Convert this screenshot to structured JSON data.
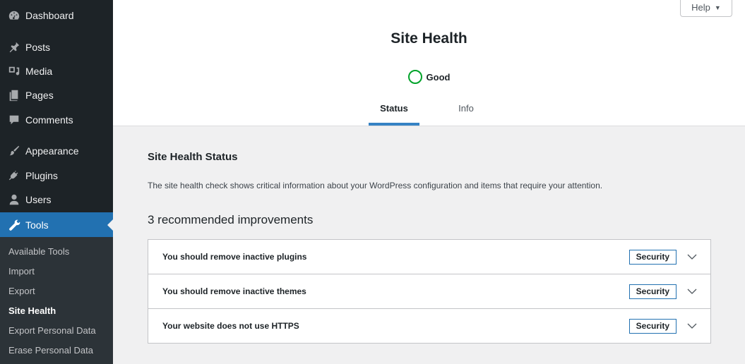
{
  "sidebar": {
    "items": [
      {
        "label": "Dashboard",
        "icon": "dashboard-icon"
      },
      {
        "label": "Posts",
        "icon": "pin-icon"
      },
      {
        "label": "Media",
        "icon": "media-icon"
      },
      {
        "label": "Pages",
        "icon": "pages-icon"
      },
      {
        "label": "Comments",
        "icon": "comment-icon"
      },
      {
        "label": "Appearance",
        "icon": "brush-icon"
      },
      {
        "label": "Plugins",
        "icon": "plug-icon"
      },
      {
        "label": "Users",
        "icon": "user-icon"
      },
      {
        "label": "Tools",
        "icon": "wrench-icon"
      }
    ],
    "submenu": [
      "Available Tools",
      "Import",
      "Export",
      "Site Health",
      "Export Personal Data",
      "Erase Personal Data"
    ]
  },
  "header": {
    "help_label": "Help",
    "help_caret": "▼",
    "title": "Site Health",
    "status": "Good",
    "tabs": [
      "Status",
      "Info"
    ]
  },
  "main": {
    "section_title": "Site Health Status",
    "description": "The site health check shows critical information about your WordPress configuration and items that require your attention.",
    "improvements_title": "3 recommended improvements",
    "issues": [
      {
        "title": "You should remove inactive plugins",
        "badge": "Security"
      },
      {
        "title": "You should remove inactive themes",
        "badge": "Security"
      },
      {
        "title": "Your website does not use HTTPS",
        "badge": "Security"
      }
    ]
  },
  "colors": {
    "sidebar_bg": "#1d2327",
    "accent": "#2271b1",
    "good": "#00a32a"
  }
}
